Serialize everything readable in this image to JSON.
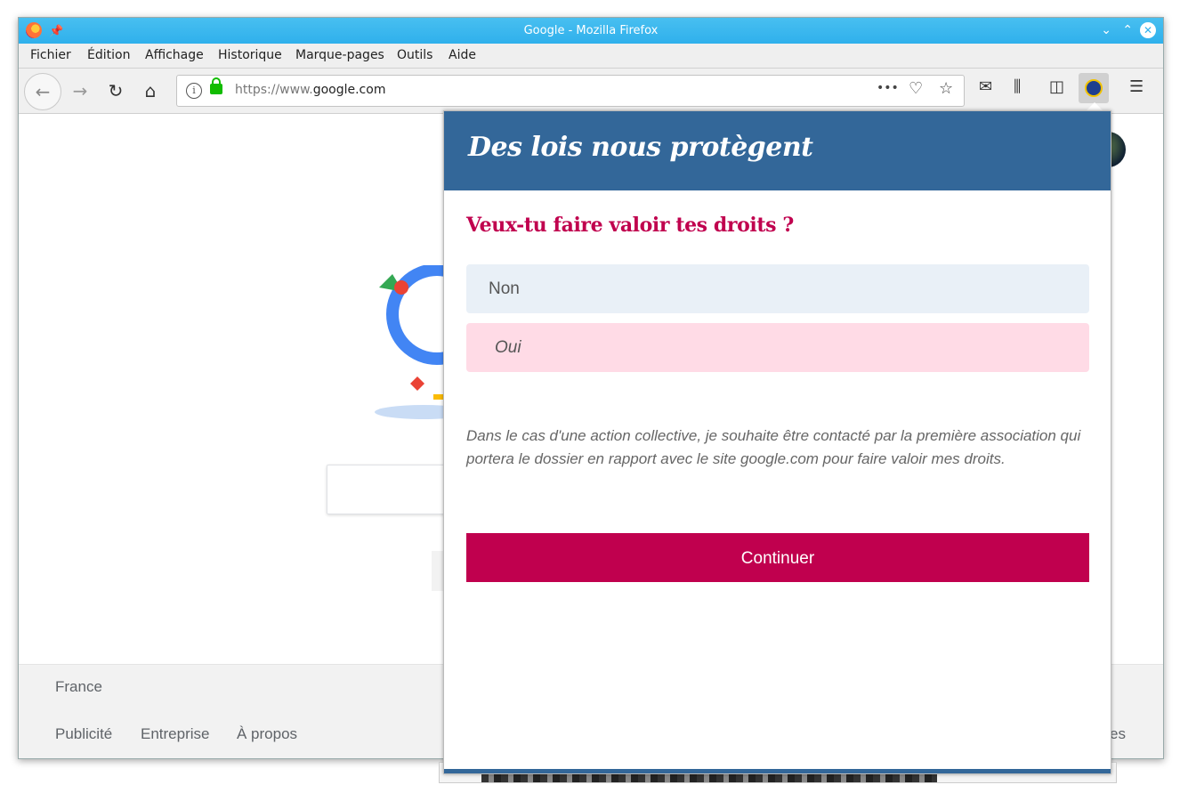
{
  "window": {
    "title": "Google - Mozilla Firefox"
  },
  "menu": [
    "Fichier",
    "Édition",
    "Affichage",
    "Historique",
    "Marque-pages",
    "Outils",
    "Aide"
  ],
  "url": {
    "prefix": "https://www.",
    "domain": "google.com",
    "more_glyph": "•••"
  },
  "footer": {
    "country": "France",
    "links": [
      "Publicité",
      "Entreprise",
      "À propos"
    ],
    "right_fragment": "es"
  },
  "popup": {
    "title": "Des lois nous protègent",
    "question": "Veux-tu faire valoir tes droits ?",
    "option_no": "Non",
    "option_yes": "Oui",
    "consent": "Dans le cas d'une action collective, je souhaite être contacté par la première association qui portera le dossier en rapport avec le site google.com pour faire valoir mes droits.",
    "continue_label": "Continuer"
  },
  "colors": {
    "header_blue": "#336799",
    "accent": "#c0004e",
    "titlebar": "#3db8ee"
  }
}
